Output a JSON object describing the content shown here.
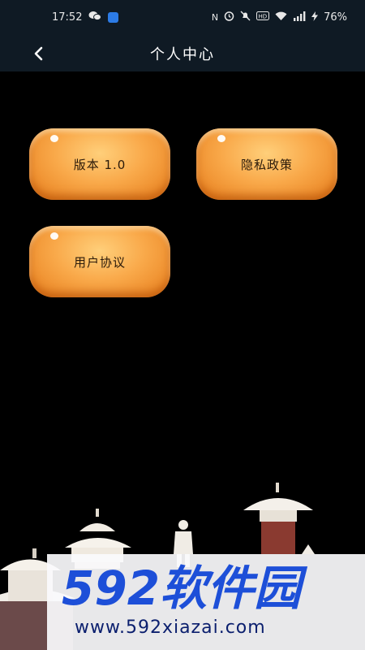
{
  "status_bar": {
    "time": "17:52",
    "battery": "76%",
    "icons": [
      "wechat-icon",
      "app-badge-icon",
      "nfc-icon",
      "alarm-icon",
      "mute-icon",
      "hd-icon",
      "wifi-icon",
      "signal-icon",
      "charging-icon"
    ]
  },
  "nav": {
    "back_icon": "chevron-left-icon",
    "title": "个人中心"
  },
  "buttons": {
    "version": "版本 1.0",
    "privacy": "隐私政策",
    "agreement": "用户协议"
  },
  "watermark": {
    "logo_text": "592软件园",
    "url": "www.592xiazai.com"
  },
  "colors": {
    "button_orange": "#f9a94a",
    "bar_bg": "#0f1a24",
    "watermark_blue": "#1d4fd8"
  }
}
